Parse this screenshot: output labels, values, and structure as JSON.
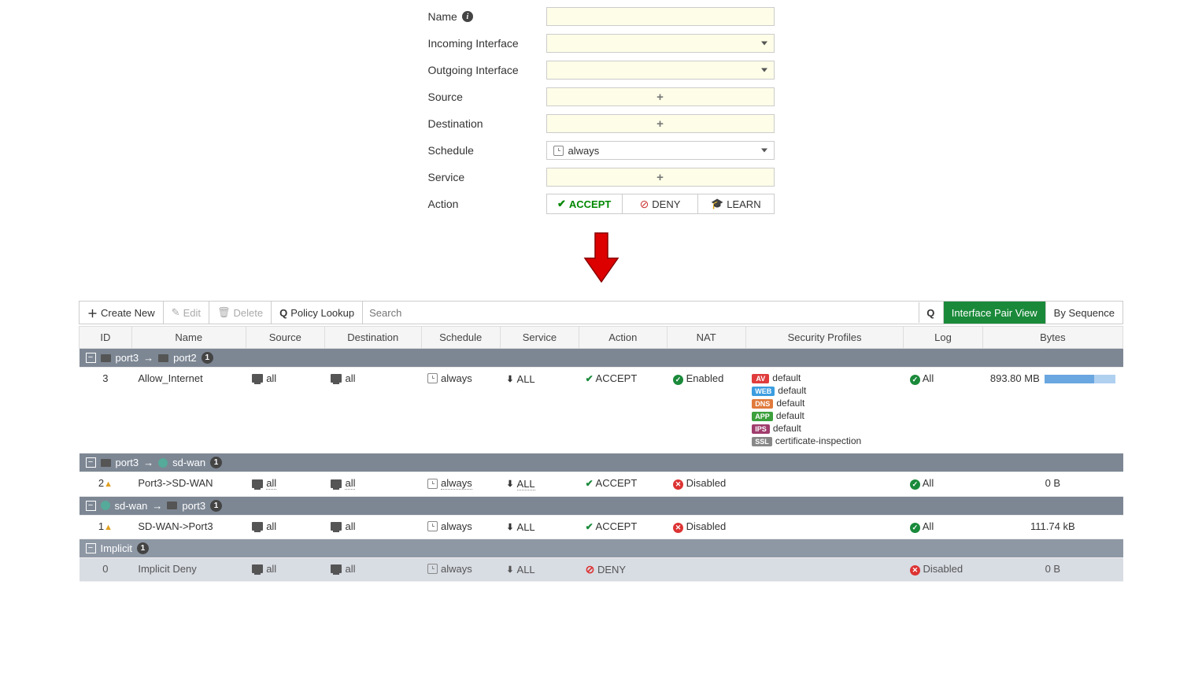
{
  "form": {
    "name_label": "Name",
    "incoming_label": "Incoming Interface",
    "outgoing_label": "Outgoing Interface",
    "source_label": "Source",
    "destination_label": "Destination",
    "schedule_label": "Schedule",
    "service_label": "Service",
    "action_label": "Action",
    "schedule_value": "always",
    "action_accept": "ACCEPT",
    "action_deny": "DENY",
    "action_learn": "LEARN",
    "plus": "+"
  },
  "toolbar": {
    "create": "Create New",
    "edit": "Edit",
    "delete": "Delete",
    "lookup": "Policy Lookup",
    "search_placeholder": "Search",
    "view_pair": "Interface Pair View",
    "view_seq": "By Sequence"
  },
  "headers": {
    "id": "ID",
    "name": "Name",
    "source": "Source",
    "destination": "Destination",
    "schedule": "Schedule",
    "service": "Service",
    "action": "Action",
    "nat": "NAT",
    "profiles": "Security Profiles",
    "log": "Log",
    "bytes": "Bytes"
  },
  "groups": [
    {
      "from": "port3",
      "to": "port2",
      "to_type": "port",
      "count": "1"
    },
    {
      "from": "port3",
      "to": "sd-wan",
      "to_type": "sdwan",
      "count": "1"
    },
    {
      "from": "sd-wan",
      "from_type": "sdwan",
      "to": "port3",
      "to_type": "port",
      "count": "1"
    }
  ],
  "implicit_label": "Implicit",
  "implicit_count": "1",
  "rows": [
    {
      "id": "3",
      "name": "Allow_Internet",
      "source": "all",
      "destination": "all",
      "schedule": "always",
      "service": "ALL",
      "action": "ACCEPT",
      "nat": "Enabled",
      "profiles": [
        {
          "tag": "AV",
          "cls": "pb-av",
          "val": "default"
        },
        {
          "tag": "WEB",
          "cls": "pb-web",
          "val": "default"
        },
        {
          "tag": "DNS",
          "cls": "pb-dns",
          "val": "default"
        },
        {
          "tag": "APP",
          "cls": "pb-app",
          "val": "default"
        },
        {
          "tag": "IPS",
          "cls": "pb-ips",
          "val": "default"
        },
        {
          "tag": "SSL",
          "cls": "pb-ssl",
          "val": "certificate-inspection"
        }
      ],
      "log": "All",
      "bytes": "893.80 MB",
      "has_bar": true
    },
    {
      "id": "2",
      "warn": true,
      "name": "Port3->SD-WAN",
      "source": "all",
      "destination": "all",
      "schedule": "always",
      "service": "ALL",
      "action": "ACCEPT",
      "nat": "Disabled",
      "nat_red": true,
      "dotted": true,
      "log": "All",
      "bytes": "0 B"
    },
    {
      "id": "1",
      "warn": true,
      "name": "SD-WAN->Port3",
      "source": "all",
      "destination": "all",
      "schedule": "always",
      "service": "ALL",
      "action": "ACCEPT",
      "nat": "Disabled",
      "nat_red": true,
      "log": "All",
      "bytes": "111.74 kB"
    }
  ],
  "implicit_row": {
    "id": "0",
    "name": "Implicit Deny",
    "source": "all",
    "destination": "all",
    "schedule": "always",
    "service": "ALL",
    "action": "DENY",
    "log": "Disabled",
    "bytes": "0 B"
  }
}
